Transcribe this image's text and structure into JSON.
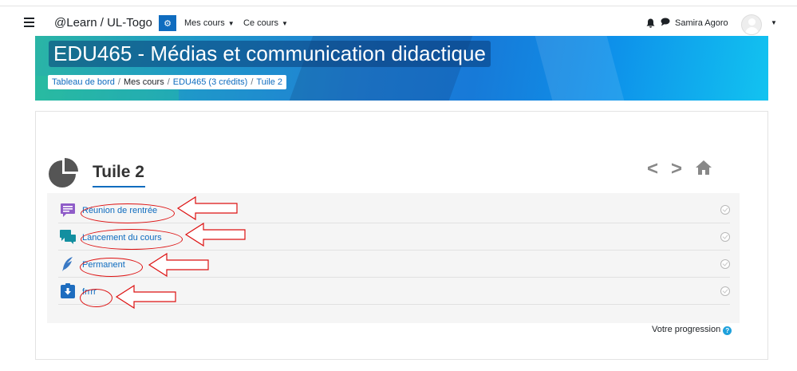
{
  "navbar": {
    "brand": "@Learn / UL-Togo",
    "menus": [
      {
        "label": "Mes cours"
      },
      {
        "label": "Ce cours"
      }
    ],
    "user_name": "Samira Agoro"
  },
  "banner": {
    "course_title": "EDU465 - Médias et communication didactique",
    "breadcrumb": [
      {
        "label": "Tableau de bord"
      },
      {
        "label": "Mes cours"
      },
      {
        "label": "EDU465 (3 crédits)"
      },
      {
        "label": "Tuile 2"
      }
    ]
  },
  "section": {
    "title": "Tuile 2",
    "activities": [
      {
        "label": "Réunion de rentrée",
        "icon": "forum-icon",
        "completed": false
      },
      {
        "label": "Lancement du cours",
        "icon": "chat-icon",
        "completed": false
      },
      {
        "label": "Permanent",
        "icon": "quill-icon",
        "completed": false
      },
      {
        "label": "frrrr",
        "icon": "assignment-icon",
        "completed": false
      }
    ]
  },
  "progress": {
    "label": "Votre progression"
  },
  "colors": {
    "accent": "#0f6cbf",
    "annotation": "#dd1111"
  }
}
